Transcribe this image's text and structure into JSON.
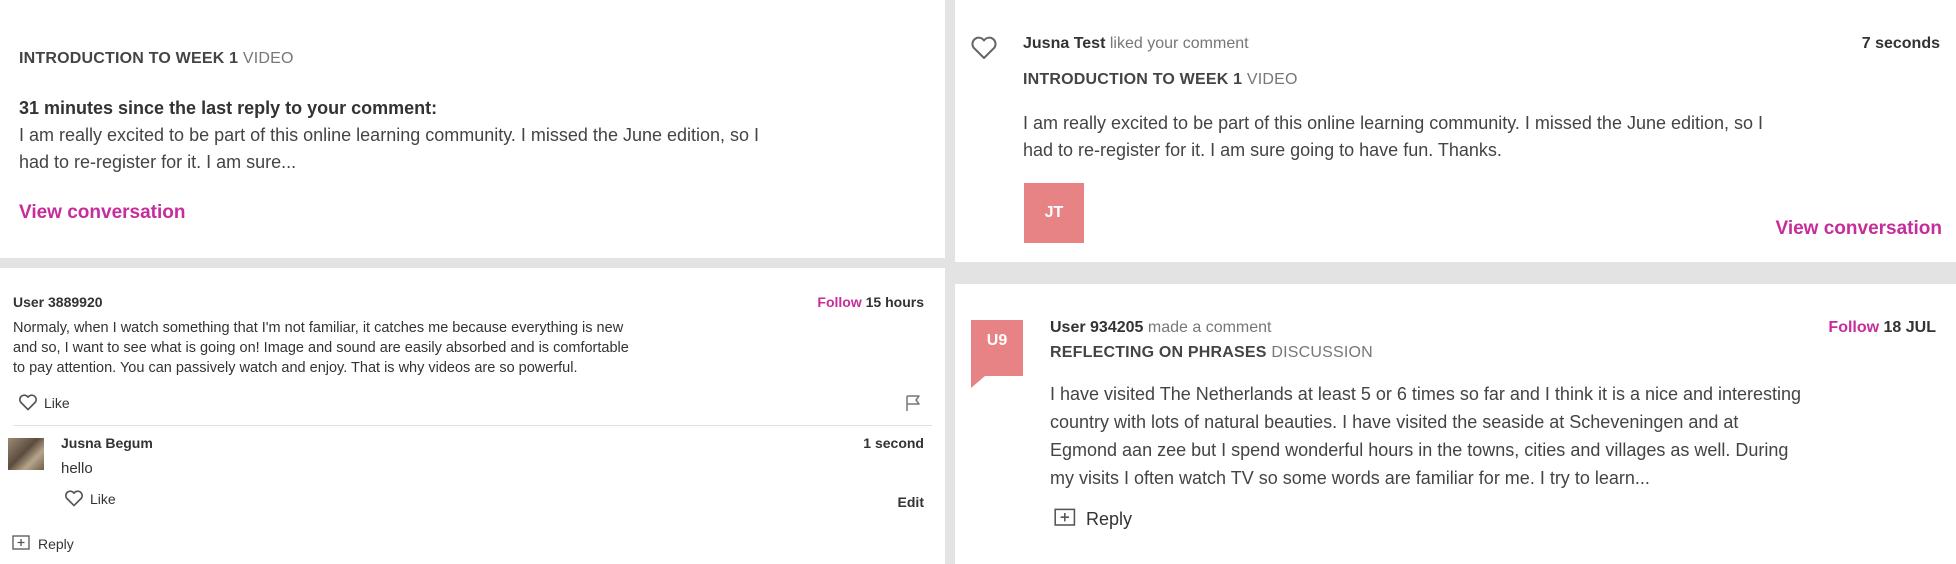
{
  "panel1": {
    "step_title": "INTRODUCTION TO WEEK 1",
    "step_type": "VIDEO",
    "since_reply": "31 minutes since the last reply to your comment:",
    "comment_lines": [
      "I am really excited to be part of this online learning community. I missed the June edition, so I",
      "had to re-register for it. I am sure..."
    ],
    "link": "View conversation"
  },
  "panel2": {
    "user": "Jusna Test",
    "action": "liked your comment",
    "time": "7 seconds",
    "step_title": "INTRODUCTION TO WEEK 1",
    "step_type": "VIDEO",
    "comment_lines": [
      "I am really excited to be part of this online learning community. I missed the June edition, so I",
      "had to re-register for it. I am sure going to have fun. Thanks."
    ],
    "avatar": "JT",
    "link": "View conversation"
  },
  "panel3": {
    "user": "User 3889920",
    "follow": "Follow",
    "time": "15 hours",
    "comment_lines": [
      "Normaly, when I watch something that I'm not familiar, it catches me because everything is new",
      "and so, I want to see what is going on! Image and sound are easily absorbed and is comfortable",
      "to pay attention. You can passively watch and enjoy. That is why videos are so powerful."
    ],
    "like": "Like",
    "reply": {
      "user": "Jusna Begum",
      "time": "1 second",
      "text": "hello",
      "like": "Like",
      "edit": "Edit"
    },
    "reply_button": "Reply"
  },
  "panel4": {
    "avatar": "U9",
    "user": "User 934205",
    "action": "made a comment",
    "follow": "Follow",
    "date": "18 JUL",
    "step_title": "REFLECTING ON PHRASES",
    "step_type": "DISCUSSION",
    "comment_lines": [
      "I have visited The Netherlands at least 5 or 6 times so far and I think it is a nice and interesting",
      "country with lots of natural beauties. I have visited the seaside at Scheveningen and at",
      "Egmond aan zee but I spend wonderful hours in the towns, cities and villages as well. During",
      "my visits I often watch TV so some words are familiar for me. I try to learn..."
    ],
    "reply_button": "Reply"
  },
  "colors": {
    "accent": "#c62d9b",
    "avatar": "#e88385",
    "background": "#e3e3e3"
  },
  "icons": [
    "heart-icon",
    "flag-icon",
    "reply-icon"
  ]
}
